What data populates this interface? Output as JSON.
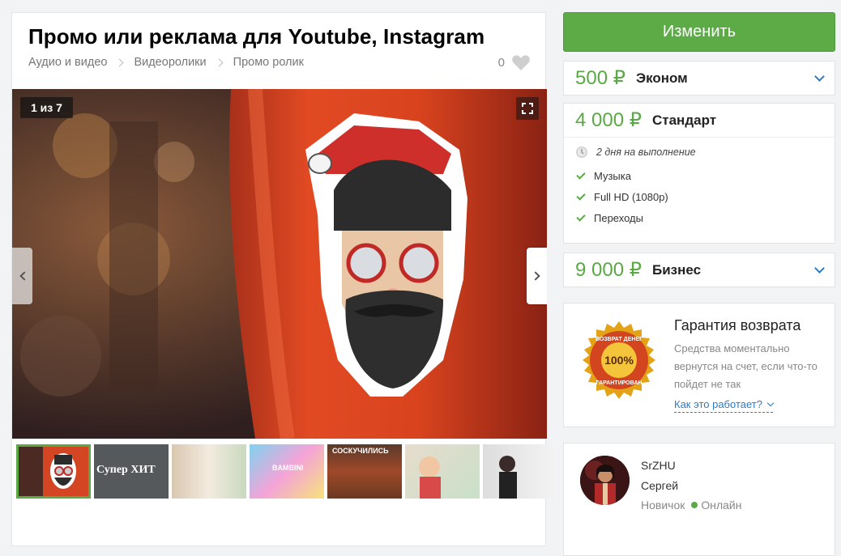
{
  "gig": {
    "title": "Промо или реклама для Youtube, Instagram",
    "breadcrumbs": [
      "Аудио и видео",
      "Видеоролики",
      "Промо ролик"
    ],
    "likes_count": "0"
  },
  "gallery": {
    "counter": "1 из 7",
    "current_index": 1,
    "total": 7,
    "thumbnails": [
      {
        "label": ""
      },
      {
        "label": "Супер ХИТ"
      },
      {
        "label": ""
      },
      {
        "label": "BAMBINI"
      },
      {
        "label": "СОСКУЧИЛИСЬ"
      },
      {
        "label": ""
      },
      {
        "label": ""
      }
    ]
  },
  "actions": {
    "change_label": "Изменить"
  },
  "packages": [
    {
      "price": "500 ₽",
      "name": "Эконом",
      "expanded": false
    },
    {
      "price": "4 000 ₽",
      "name": "Стандарт",
      "expanded": true,
      "duration": "2 дня на выполнение",
      "features": [
        "Музыка",
        "Full HD (1080p)",
        "Переходы"
      ]
    },
    {
      "price": "9 000 ₽",
      "name": "Бизнес",
      "expanded": false
    }
  ],
  "guarantee": {
    "title": "Гарантия возврата",
    "text": "Средства моментально вернутся на счет, если что-то пойдет не так",
    "link": "Как это работает?",
    "seal_top": "ВОЗВРАТ ДЕНЕГ",
    "seal_percent": "100%",
    "seal_bottom": "ГАРАНТИРОВАН"
  },
  "seller": {
    "login": "SrZHU",
    "name": "Сергей",
    "level": "Новичок",
    "online": "Онлайн"
  },
  "colors": {
    "accent_green": "#5cab47",
    "link_blue": "#2e7bc4",
    "price_green": "#5aa846"
  }
}
